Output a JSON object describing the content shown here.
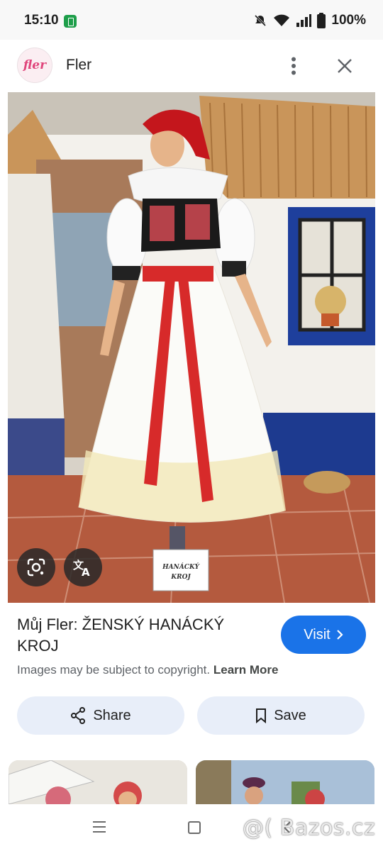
{
  "status_bar": {
    "time": "15:10",
    "battery_percent": "100%",
    "icons": [
      "battery-saver-icon",
      "mute-icon",
      "wifi-icon",
      "signal-icon",
      "battery-icon"
    ]
  },
  "header": {
    "logo_text": "fler",
    "site_name": "Fler",
    "icons": [
      "more-vert-icon",
      "close-icon"
    ]
  },
  "image": {
    "label_sign": [
      "HANÁCKÝ",
      "KROJ"
    ],
    "overlay_icons": [
      "google-lens-icon",
      "translate-icon"
    ]
  },
  "result": {
    "title": "Můj Fler: ŽENSKÝ HANÁCKÝ KROJ",
    "visit_label": "Visit",
    "copyright_text": "Images may be subject to copyright.",
    "learn_more": "Learn More"
  },
  "actions": {
    "share_label": "Share",
    "save_label": "Save"
  },
  "watermark": "@( Bazos.cz",
  "colors": {
    "accent": "#1a73e8",
    "action_bg": "#e8eef9",
    "logo_pink": "#e0457b"
  }
}
